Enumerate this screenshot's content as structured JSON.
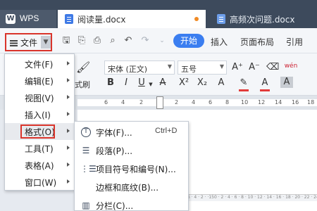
{
  "app": {
    "name": "WPS"
  },
  "tabs": [
    {
      "label": "阅读量.docx",
      "active": true
    },
    {
      "label": "高频次问题.docx",
      "active": false
    }
  ],
  "toolbar": {
    "file_label": "文件",
    "ribbon_tabs": [
      "开始",
      "插入",
      "页面布局",
      "引用"
    ]
  },
  "ribbon": {
    "font_name": "宋体 (正文)",
    "font_size": "五号",
    "format_painter_label": "式刷"
  },
  "ruler": {
    "numbers": [
      "6",
      "4",
      "2",
      "2",
      "4",
      "6",
      "8",
      "10",
      "12",
      "14",
      "16",
      "18"
    ],
    "bottom_ticks": "· 6 · 4 · 2 · ·150 · 2 · 4 · 6 · 8 · 10 · 12 · 14 · 16 · 18 · 20 · 22 · 24 · 26"
  },
  "main_menu": [
    {
      "label": "文件(F)"
    },
    {
      "label": "编辑(E)"
    },
    {
      "label": "视图(V)"
    },
    {
      "label": "插入(I)"
    },
    {
      "label": "格式(O)"
    },
    {
      "label": "工具(T)"
    },
    {
      "label": "表格(A)"
    },
    {
      "label": "窗口(W)"
    }
  ],
  "format_submenu": [
    {
      "label": "字体(F)...",
      "shortcut": "Ctrl+D",
      "icon": "font-icon"
    },
    {
      "label": "段落(P)...",
      "shortcut": "",
      "icon": "paragraph-icon"
    },
    {
      "label": "项目符号和编号(N)...",
      "shortcut": "",
      "icon": "list-icon"
    },
    {
      "label": "边框和底纹(B)...",
      "shortcut": "",
      "icon": "border-icon"
    },
    {
      "label": "分栏(C)...",
      "shortcut": "",
      "icon": "columns-icon"
    }
  ],
  "colors": {
    "accent": "#3b7ef0",
    "highlight_border": "#d9342b",
    "tabbar": "#3d4a5c"
  }
}
